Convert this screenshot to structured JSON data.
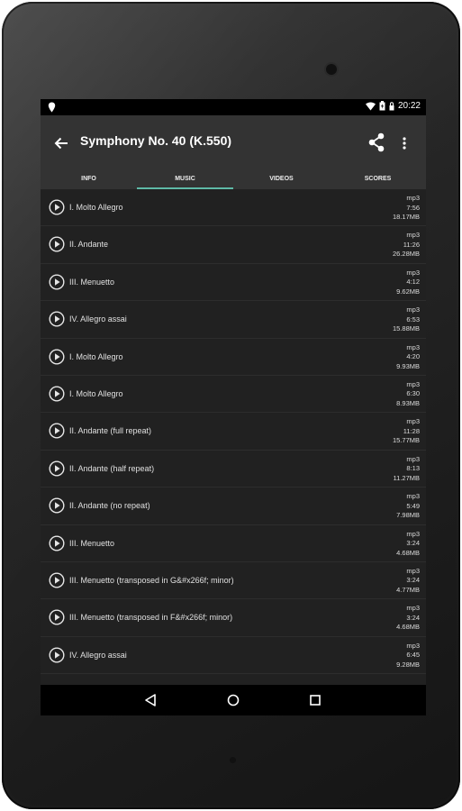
{
  "status_bar": {
    "time": "20:22"
  },
  "app_bar": {
    "title": "Symphony No. 40 (K.550)"
  },
  "tabs": [
    {
      "label": "INFO"
    },
    {
      "label": "MUSIC"
    },
    {
      "label": "VIDEOS"
    },
    {
      "label": "SCORES"
    }
  ],
  "active_tab": "MUSIC",
  "accent_color": "#5eb9a6",
  "tracks": [
    {
      "title": "I. Molto Allegro",
      "format": "mp3",
      "duration": "7:56",
      "size": "18.17MB"
    },
    {
      "title": "II. Andante",
      "format": "mp3",
      "duration": "11:26",
      "size": "26.28MB"
    },
    {
      "title": "III. Menuetto",
      "format": "mp3",
      "duration": "4:12",
      "size": "9.62MB"
    },
    {
      "title": "IV. Allegro assai",
      "format": "mp3",
      "duration": "6:53",
      "size": "15.88MB"
    },
    {
      "title": "I. Molto Allegro",
      "format": "mp3",
      "duration": "4:20",
      "size": "9.93MB"
    },
    {
      "title": "I. Molto Allegro",
      "format": "mp3",
      "duration": "6:30",
      "size": "8.93MB"
    },
    {
      "title": "II. Andante (full repeat)",
      "format": "mp3",
      "duration": "11:28",
      "size": "15.77MB"
    },
    {
      "title": "II. Andante (half repeat)",
      "format": "mp3",
      "duration": "8:13",
      "size": "11.27MB"
    },
    {
      "title": "II. Andante (no repeat)",
      "format": "mp3",
      "duration": "5:49",
      "size": "7.98MB"
    },
    {
      "title": "III. Menuetto",
      "format": "mp3",
      "duration": "3:24",
      "size": "4.68MB"
    },
    {
      "title": "III. Menuetto (transposed in G&#x266f; minor)",
      "format": "mp3",
      "duration": "3:24",
      "size": "4.77MB"
    },
    {
      "title": "III. Menuetto (transposed in F&#x266f; minor)",
      "format": "mp3",
      "duration": "3:24",
      "size": "4.68MB"
    },
    {
      "title": "IV. Allegro assai",
      "format": "mp3",
      "duration": "6:45",
      "size": "9.28MB"
    }
  ]
}
